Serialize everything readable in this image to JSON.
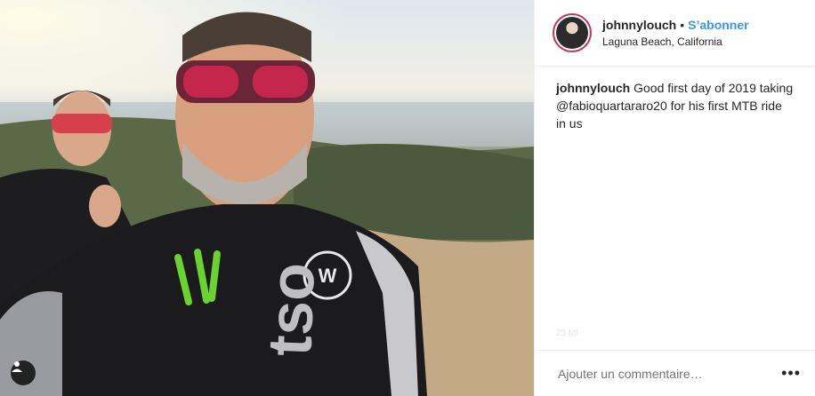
{
  "post": {
    "username": "johnnylouch",
    "separator": "•",
    "follow_label": "S’abonner",
    "location": "Laguna Beach, California",
    "caption_username": "johnnylouch",
    "caption_text": " Good first day of 2019 taking @fabioquartararo20 for his first MTB ride in us",
    "comment_placeholder": "Ajouter un commentaire…",
    "more_label": "•••",
    "faint_date": "23 MI"
  },
  "colors": {
    "follow": "#3897f0",
    "avatar_ring": "#c1355b",
    "text": "#262626"
  },
  "icons": {
    "user_tag": "user-tag-icon",
    "more": "more-options-icon"
  }
}
